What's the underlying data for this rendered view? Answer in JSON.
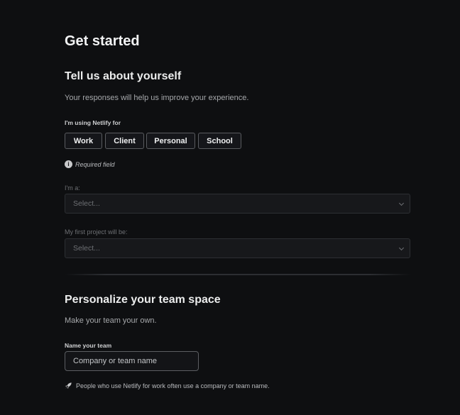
{
  "page": {
    "title": "Get started"
  },
  "about": {
    "heading": "Tell us about yourself",
    "subtitle": "Your responses will help us improve your experience.",
    "usage_label": "I'm using Netlify for",
    "usage_options": [
      "Work",
      "Client",
      "Personal",
      "School"
    ],
    "required_note": "Required field",
    "role": {
      "label": "I'm a:",
      "value": "Select..."
    },
    "first_project": {
      "label": "My first project will be:",
      "value": "Select..."
    }
  },
  "team": {
    "heading": "Personalize your team space",
    "subtitle": "Make your team your own.",
    "name_label": "Name your team",
    "name_placeholder": "Company or team name",
    "name_value": "",
    "hint": "People who use Netlify for work often use a company or team name."
  },
  "icons": {
    "info": "info-icon",
    "chevron": "chevron-down-icon",
    "rocket": "rocket-icon"
  },
  "colors": {
    "background": "#0e0f11",
    "chip_border": "#5a5c60",
    "select_bg": "#17181b",
    "text_primary": "#f2f3f4",
    "text_muted": "#a6a8ab"
  }
}
